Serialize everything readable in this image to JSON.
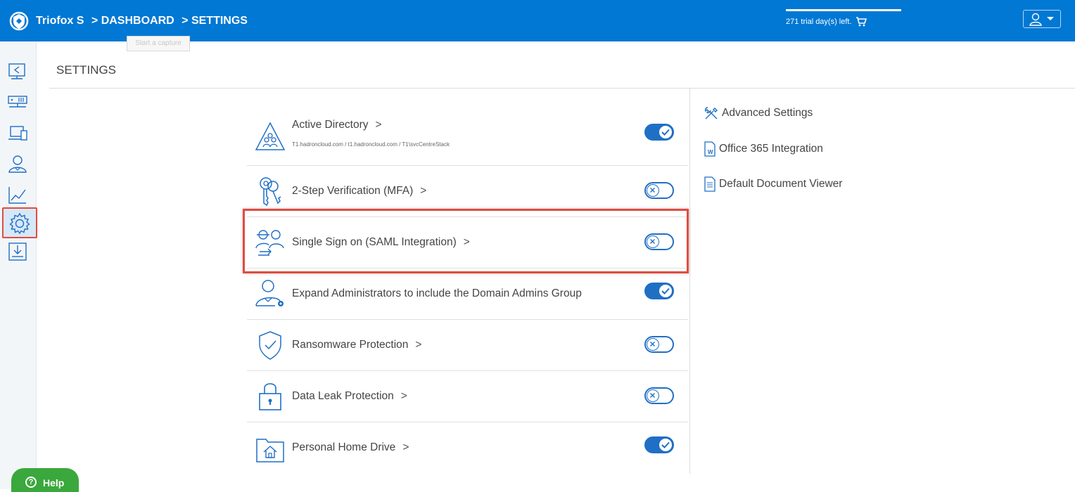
{
  "header": {
    "brand": "Triofox S",
    "breadcrumb": [
      "> DASHBOARD",
      "> SETTINGS"
    ],
    "trial_text": "271 trial day(s) left.",
    "tooltip": "Start a capture",
    "accent": "#0078d4"
  },
  "sidebar": {
    "items": [
      {
        "name": "sidebar-item-shares",
        "icon": "share-monitor-icon"
      },
      {
        "name": "sidebar-item-servers",
        "icon": "server-rack-icon"
      },
      {
        "name": "sidebar-item-devices",
        "icon": "devices-icon"
      },
      {
        "name": "sidebar-item-users",
        "icon": "users-icon"
      },
      {
        "name": "sidebar-item-reports",
        "icon": "chart-icon"
      },
      {
        "name": "sidebar-item-settings",
        "icon": "gear-icon",
        "active": true
      },
      {
        "name": "sidebar-item-downloads",
        "icon": "download-icon"
      }
    ]
  },
  "page": {
    "title": "SETTINGS"
  },
  "settings": [
    {
      "label": "Active Directory",
      "sub": "T1.hadroncloud.com / t1.hadroncloud.com / T1\\svcCentreStack",
      "chevron": true,
      "enabled": true
    },
    {
      "label": "2-Step Verification (MFA)",
      "chevron": true,
      "enabled": false
    },
    {
      "label": "Single Sign on (SAML Integration)",
      "chevron": true,
      "enabled": false
    },
    {
      "label": "Expand Administrators to include the Domain Admins Group",
      "chevron": false,
      "enabled": true
    },
    {
      "label": "Ransomware Protection",
      "chevron": true,
      "enabled": false
    },
    {
      "label": "Data Leak Protection",
      "chevron": true,
      "enabled": false
    },
    {
      "label": "Personal Home Drive",
      "chevron": true,
      "enabled": true
    }
  ],
  "right_links": [
    {
      "label": "Advanced Settings",
      "icon": "tools-icon"
    },
    {
      "label": "Office 365 Integration",
      "icon": "word-document-icon"
    },
    {
      "label": "Default Document Viewer",
      "icon": "document-icon"
    }
  ],
  "help": {
    "label": "Help"
  },
  "chevron_glyph": ">"
}
